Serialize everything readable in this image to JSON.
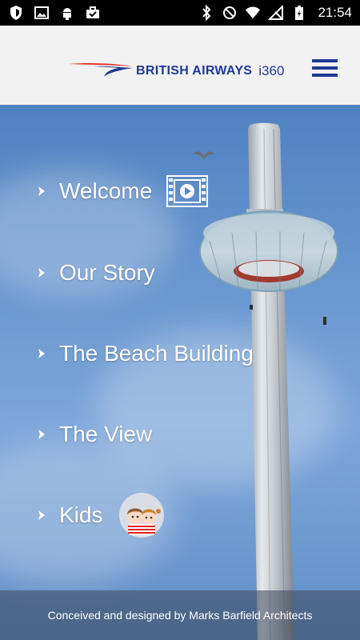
{
  "status_bar": {
    "time": "21:54",
    "left_icons": [
      "shield-icon",
      "image-icon",
      "android-icon",
      "briefcase-icon"
    ],
    "right_icons": [
      "bluetooth-icon",
      "do-not-disturb-icon",
      "wifi-icon",
      "signal-off-icon",
      "battery-charging-icon"
    ]
  },
  "header": {
    "brand_name": "BRITISH AIRWAYS",
    "brand_sub": "i360",
    "brand_color": "#1f3a93",
    "accent_red": "#e2231a",
    "menu_icon": "hamburger-menu-icon"
  },
  "nav": {
    "items": [
      {
        "label": "Welcome",
        "icon": "video-play-icon"
      },
      {
        "label": "Our Story"
      },
      {
        "label": "The Beach Building"
      },
      {
        "label": "The View"
      },
      {
        "label": "Kids",
        "icon": "kids-avatar-icon"
      }
    ]
  },
  "footer": {
    "text": "Conceived and designed by Marks Barfield Architects"
  }
}
